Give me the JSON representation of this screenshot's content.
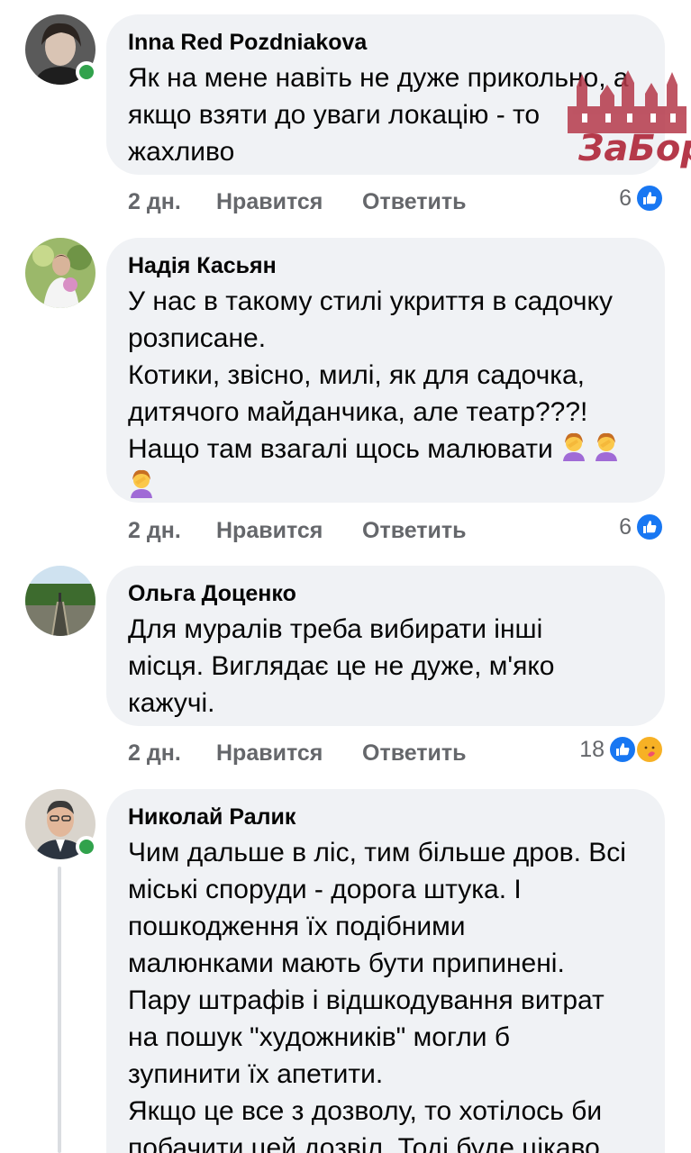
{
  "comments": [
    {
      "author": "Inna Red Pozdniakova",
      "lines": [
        "Як на мене навіть не дуже прикольно, а",
        "якщо взяти до уваги локацію - то",
        "жахливо"
      ],
      "time": "2 дн.",
      "like_label": "Нравится",
      "reply_label": "Ответить",
      "reaction_count": "6",
      "online": true
    },
    {
      "author": "Надія Касьян",
      "lines": [
        "У нас в такому стилі укриття в садочку",
        "розписане.",
        "Котики, звісно, милі, як для садочка,",
        "дитячого майданчика, але театр???!",
        "Нащо там взагалі щось малювати"
      ],
      "time": "2 дн.",
      "like_label": "Нравится",
      "reply_label": "Ответить",
      "reaction_count": "6",
      "online": false
    },
    {
      "author": "Ольга Доценко",
      "lines": [
        "Для муралів треба вибирати інші",
        "місця. Виглядає це не дуже, м'яко",
        "кажучі."
      ],
      "time": "2 дн.",
      "like_label": "Нравится",
      "reply_label": "Ответить",
      "reaction_count": "18",
      "online": false
    },
    {
      "author": "Николай Ралик",
      "lines": [
        "Чим дальше в ліс, тим більше дров. Всі",
        "міські споруди - дорога штука. І",
        "пошкодження їх подібними",
        "малюнками мають бути припинені.",
        "Пару штрафів і відшкодування витрат",
        "на пошук \"художників\" могли б",
        "зупинити їх апетити.",
        "Якщо це все з дозволу, то хотілось би",
        "побачити цей дозвіл. Тоді буде цікаво,"
      ],
      "online": true
    }
  ],
  "watermark": {
    "text": "ЗаБор"
  },
  "icons": {
    "like": "thumbs-up-icon",
    "care": "care-reaction-icon",
    "facepalm": "woman-facepalming-emoji"
  },
  "colors": {
    "bubble": "#f0f2f5",
    "like_blue": "#1877f2",
    "online_green": "#31a24c",
    "meta_grey": "#65676b",
    "watermark": "#b5394a"
  }
}
